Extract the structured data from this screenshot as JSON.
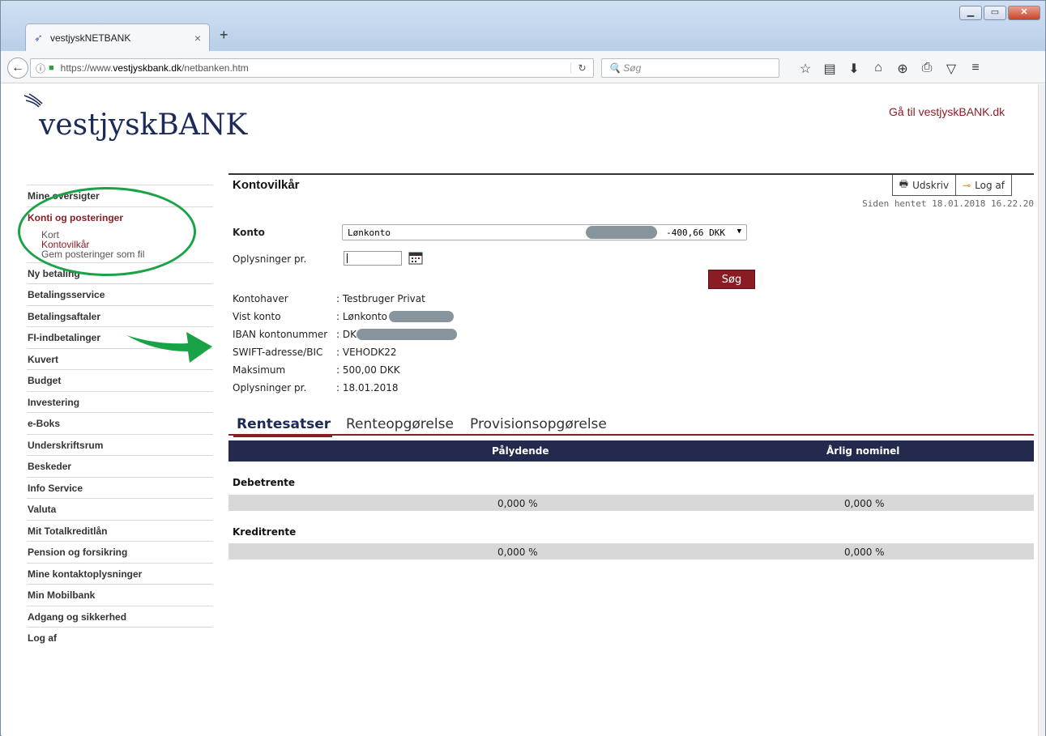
{
  "browser": {
    "tab_title": "vestjyskNETBANK",
    "url_prefix": "https://www.",
    "url_domain": "vestjyskbank.dk",
    "url_path": "/netbanken.htm",
    "search_placeholder": "Søg"
  },
  "header": {
    "logo_text": "vestjyskBANK",
    "goto_link": "Gå til vestjyskBANK.dk"
  },
  "sidebar": {
    "items_top": [
      {
        "label": "Mine oversigter"
      }
    ],
    "active_group": {
      "label": "Konti og posteringer",
      "subitems": [
        {
          "label": "Kort",
          "active": false
        },
        {
          "label": "Kontovilkår",
          "active": true
        },
        {
          "label": "Gem posteringer som fil",
          "active": false
        }
      ]
    },
    "items": [
      {
        "label": "Ny betaling"
      },
      {
        "label": "Betalingsservice"
      },
      {
        "label": "Betalingsaftaler"
      },
      {
        "label": "FI-indbetalinger"
      },
      {
        "label": "Kuvert"
      },
      {
        "label": "Budget"
      },
      {
        "label": "Investering"
      },
      {
        "label": "e-Boks"
      },
      {
        "label": "Underskriftsrum"
      },
      {
        "label": "Beskeder"
      },
      {
        "label": "Info Service"
      },
      {
        "label": "Valuta"
      },
      {
        "label": "Mit Totalkreditlån"
      },
      {
        "label": "Pension og forsikring"
      },
      {
        "label": "Mine kontaktoplysninger"
      },
      {
        "label": "Min Mobilbank"
      },
      {
        "label": "Adgang og sikkerhed"
      },
      {
        "label": "Log af"
      }
    ]
  },
  "main": {
    "title": "Kontovilkår",
    "print_label": "Udskriv",
    "logout_label": "Log af",
    "fetched": "Siden hentet 18.01.2018 16.22.20",
    "konto_label": "Konto",
    "konto_value": "Lønkonto",
    "konto_amount": "-400,66 DKK",
    "oplysninger_label": "Oplysninger pr.",
    "oplysninger_value": "",
    "search_button": "Søg",
    "info": [
      {
        "k": "Kontohaver",
        "v": ": Testbruger Privat"
      },
      {
        "k": "Vist konto",
        "v": ": Lønkonto"
      },
      {
        "k": "IBAN kontonummer",
        "v": ": DK"
      },
      {
        "k": "SWIFT-adresse/BIC",
        "v": ": VEHODK22"
      },
      {
        "k": "Maksimum",
        "v": ": 500,00 DKK"
      },
      {
        "k": "Oplysninger pr.",
        "v": ": 18.01.2018"
      }
    ],
    "tabs": [
      {
        "label": "Rentesatser",
        "active": true
      },
      {
        "label": "Renteopgørelse",
        "active": false
      },
      {
        "label": "Provisionsopgørelse",
        "active": false
      }
    ],
    "table": {
      "col1": "Pålydende",
      "col2": "Årlig nominel",
      "sections": [
        {
          "label": "Debetrente",
          "v1": "0,000 %",
          "v2": "0,000 %"
        },
        {
          "label": "Kreditrente",
          "v1": "0,000 %",
          "v2": "0,000 %"
        }
      ]
    }
  },
  "colors": {
    "accent": "#8a1d24",
    "navy": "#1c2a57",
    "annotation": "#19a346"
  }
}
